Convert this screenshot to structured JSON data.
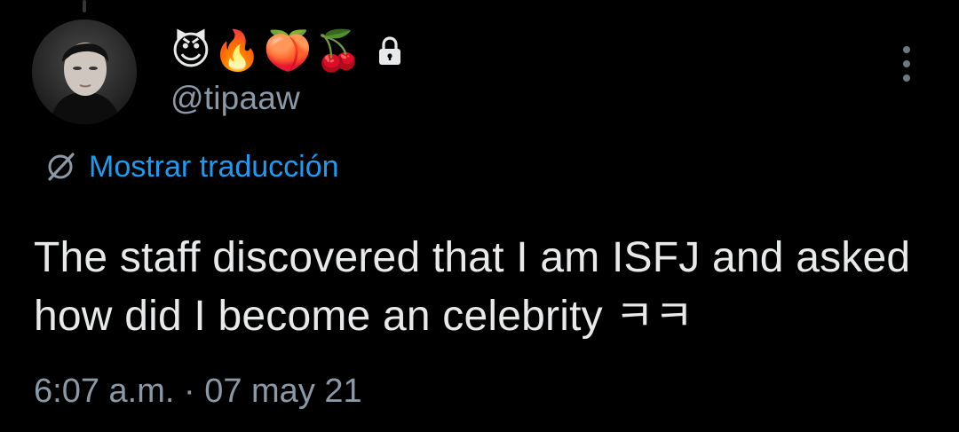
{
  "tweet": {
    "emojis": [
      {
        "name": "smiling-devil-icon",
        "glyph": "😈"
      },
      {
        "name": "fire-icon",
        "glyph": "🔥"
      },
      {
        "name": "peach-icon",
        "glyph": "🍑"
      },
      {
        "name": "cherries-icon",
        "glyph": "🍒"
      }
    ],
    "handle": "@tipaaw",
    "translate_label": "Mostrar traducción",
    "text": "The staff discovered that I am ISFJ and asked how did I become an celebrity ㅋㅋ",
    "time": "6:07 a.m.",
    "separator": "·",
    "date": "07 may 21"
  },
  "colors": {
    "background": "#000000",
    "text": "#e7e9ea",
    "secondary": "#8b98a5",
    "link": "#1d9bf0"
  },
  "icons": {
    "lock": "lock-icon",
    "more": "more-options-icon",
    "translate": "globe-slash-icon"
  }
}
